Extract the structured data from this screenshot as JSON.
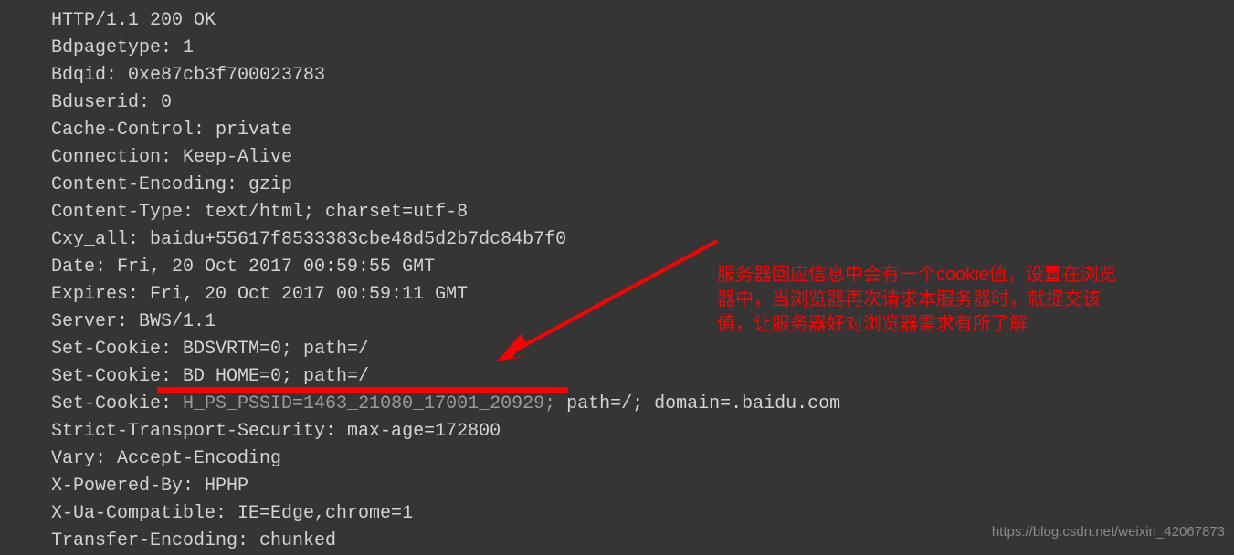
{
  "headers": {
    "status": "HTTP/1.1 200 OK",
    "bdpagetype": "Bdpagetype: 1",
    "bdqid": "Bdqid: 0xe87cb3f700023783",
    "bduserid": "Bduserid: 0",
    "cache_control": "Cache-Control: private",
    "connection": "Connection: Keep-Alive",
    "content_encoding": "Content-Encoding: gzip",
    "content_type": "Content-Type: text/html; charset=utf-8",
    "cxy_all": "Cxy_all: baidu+55617f8533383cbe48d5d2b7dc84b7f0",
    "date": "Date: Fri, 20 Oct 2017 00:59:55 GMT",
    "expires": "Expires: Fri, 20 Oct 2017 00:59:11 GMT",
    "server": "Server: BWS/1.1",
    "set_cookie_1": "Set-Cookie: BDSVRTM=0; path=/",
    "set_cookie_2": "Set-Cookie: BD_HOME=0; path=/",
    "set_cookie_3_prefix": "Set-Cookie: ",
    "set_cookie_3_highlighted": "H_PS_PSSID=1463_21080_17001_20929;",
    "set_cookie_3_suffix": " path=/; domain=.baidu.com",
    "strict_transport": "Strict-Transport-Security: max-age=172800",
    "vary": "Vary: Accept-Encoding",
    "x_powered_by": "X-Powered-By: HPHP",
    "x_ua_compatible": "X-Ua-Compatible: IE=Edge,chrome=1",
    "transfer_encoding": "Transfer-Encoding: chunked"
  },
  "annotation": {
    "line1": "服务器回应信息中会有一个cookie值，设置在浏览",
    "line2": "器中，当浏览器再次请求本服务器时，就提交该",
    "line3": "值，让服务器好对浏览器需求有所了解"
  },
  "watermark": "https://blog.csdn.net/weixin_42067873"
}
